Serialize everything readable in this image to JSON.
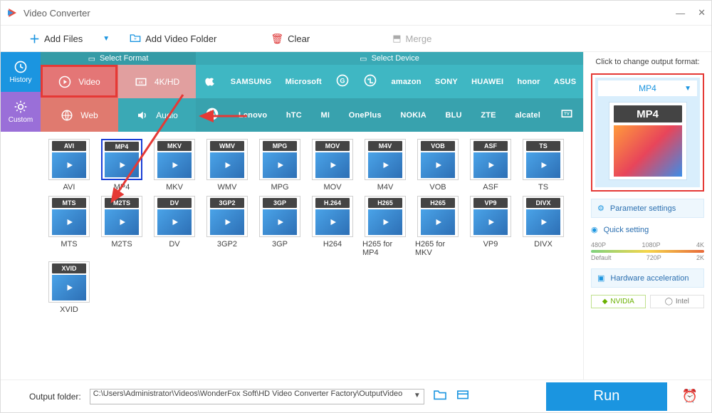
{
  "title": "Video Converter",
  "toolbar": {
    "add_files": "Add Files",
    "add_folder": "Add Video Folder",
    "clear": "Clear",
    "merge": "Merge"
  },
  "leftStrip": {
    "history": "History",
    "custom": "Custom"
  },
  "tabHeader": {
    "format": "Select Format",
    "device": "Select Device"
  },
  "fmtButtons": {
    "video": "Video",
    "hd": "4K/HD",
    "web": "Web",
    "audio": "Audio"
  },
  "brands_row1": [
    "Apple",
    "SAMSUNG",
    "Microsoft",
    "G",
    "LG",
    "amazon",
    "SONY",
    "HUAWEI",
    "honor",
    "ASUS"
  ],
  "brands_row2": [
    "Moto",
    "Lenovo",
    "hTC",
    "MI",
    "OnePlus",
    "NOKIA",
    "BLU",
    "ZTE",
    "alcatel",
    "TV"
  ],
  "formats": [
    {
      "tag": "AVI",
      "label": "AVI"
    },
    {
      "tag": "MP4",
      "label": "MP4",
      "selected": true
    },
    {
      "tag": "MKV",
      "label": "MKV"
    },
    {
      "tag": "WMV",
      "label": "WMV"
    },
    {
      "tag": "MPG",
      "label": "MPG"
    },
    {
      "tag": "MOV",
      "label": "MOV"
    },
    {
      "tag": "M4V",
      "label": "M4V"
    },
    {
      "tag": "VOB",
      "label": "VOB"
    },
    {
      "tag": "ASF",
      "label": "ASF"
    },
    {
      "tag": "TS",
      "label": "TS"
    },
    {
      "tag": "MTS",
      "label": "MTS"
    },
    {
      "tag": "M2TS",
      "label": "M2TS"
    },
    {
      "tag": "DV",
      "label": "DV"
    },
    {
      "tag": "3GP2",
      "label": "3GP2"
    },
    {
      "tag": "3GP",
      "label": "3GP"
    },
    {
      "tag": "H.264",
      "label": "H264"
    },
    {
      "tag": "H265",
      "label": "H265 for MP4"
    },
    {
      "tag": "H265",
      "label": "H265 for MKV"
    },
    {
      "tag": "VP9",
      "label": "VP9"
    },
    {
      "tag": "DIVX",
      "label": "DIVX"
    },
    {
      "tag": "XVID",
      "label": "XVID"
    }
  ],
  "rightPanel": {
    "head": "Click to change output format:",
    "selected": "MP4",
    "param": "Parameter settings",
    "quick": "Quick setting",
    "q_top": [
      "480P",
      "1080P",
      "4K"
    ],
    "q_bot": [
      "Default",
      "720P",
      "2K"
    ],
    "hw": "Hardware acceleration",
    "nv": "NVIDIA",
    "intel": "Intel"
  },
  "bottom": {
    "label": "Output folder:",
    "path": "C:\\Users\\Administrator\\Videos\\WonderFox Soft\\HD Video Converter Factory\\OutputVideo",
    "run": "Run"
  }
}
